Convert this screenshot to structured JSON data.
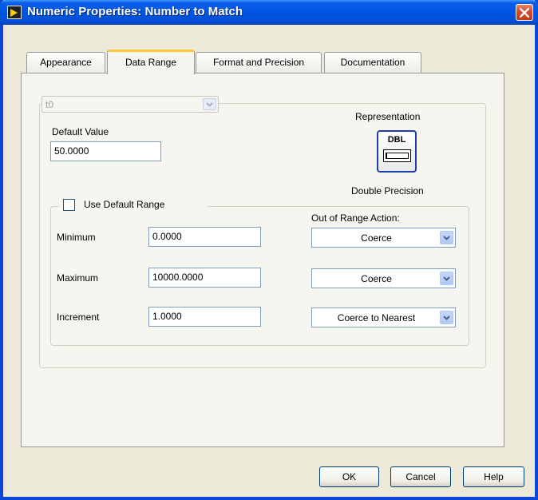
{
  "window": {
    "title": "Numeric Properties: Number to Match"
  },
  "tabs": [
    {
      "label": "Appearance"
    },
    {
      "label": "Data Range"
    },
    {
      "label": "Format and Precision"
    },
    {
      "label": "Documentation"
    }
  ],
  "active_tab": "Data Range",
  "data_range": {
    "data_type_combo": "t0",
    "default_value_label": "Default Value",
    "default_value": "50.0000",
    "representation_label": "Representation",
    "representation_icon_text": "DBL",
    "representation_type": "Double Precision",
    "use_default_range_label": "Use Default Range",
    "use_default_range_checked": false,
    "out_of_range_label": "Out of Range Action:",
    "minimum_label": "Minimum",
    "minimum_value": "0.0000",
    "minimum_action": "Coerce",
    "maximum_label": "Maximum",
    "maximum_value": "10000.0000",
    "maximum_action": "Coerce",
    "increment_label": "Increment",
    "increment_value": "1.0000",
    "increment_action": "Coerce to Nearest"
  },
  "buttons": {
    "ok": "OK",
    "cancel": "Cancel",
    "help": "Help"
  },
  "colors": {
    "titlebar": "#0054e3",
    "active_tab_highlight": "#ffc73c",
    "close_button": "#d7472b"
  },
  "icons": [
    "labview-app-icon",
    "close-icon",
    "chevron-down-icon",
    "dbl-representation-icon"
  ]
}
